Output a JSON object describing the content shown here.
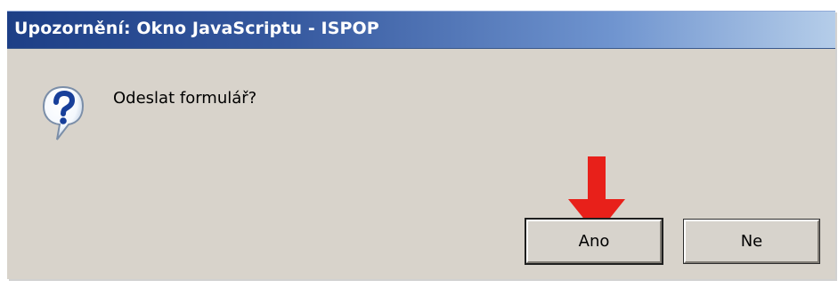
{
  "window": {
    "title": "Upozornění: Okno JavaScriptu - ISPOP"
  },
  "dialog": {
    "message": "Odeslat formulář?",
    "icon": "question-mark-icon"
  },
  "buttons": {
    "yes_label": "Ano",
    "no_label": "Ne"
  },
  "annotation": {
    "icon": "down-arrow-icon",
    "color": "#e8201a"
  },
  "colors": {
    "dialog_background": "#d8d3cb",
    "title_gradient_start": "#1d3f86",
    "title_gradient_end": "#b5cde9"
  }
}
